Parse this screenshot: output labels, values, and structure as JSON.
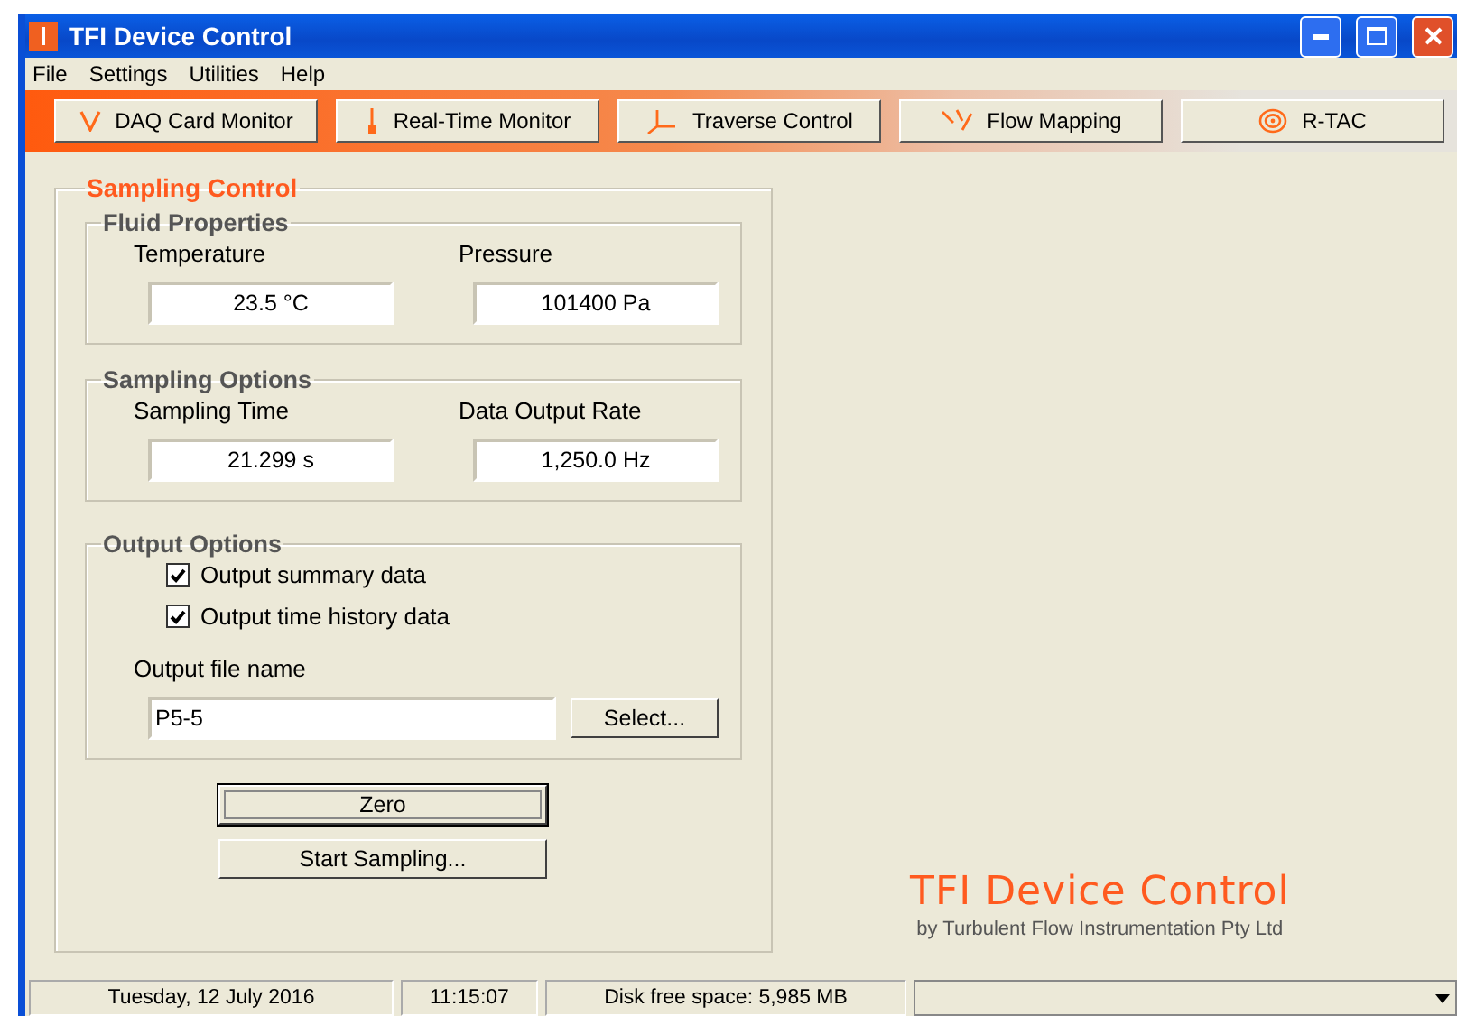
{
  "window": {
    "title": "TFI Device Control"
  },
  "menu": [
    "File",
    "Settings",
    "Utilities",
    "Help"
  ],
  "toolbar": [
    {
      "label": "DAQ Card Monitor",
      "kind": "daq"
    },
    {
      "label": "Real-Time Monitor",
      "kind": "probe"
    },
    {
      "label": "Traverse Control",
      "kind": "axes"
    },
    {
      "label": "Flow Mapping",
      "kind": "flow"
    },
    {
      "label": "R-TAC",
      "kind": "rtac"
    }
  ],
  "sampling_control": {
    "title": "Sampling Control",
    "fluid_properties": {
      "title": "Fluid Properties",
      "fields": [
        {
          "label": "Temperature",
          "value": "23.5 °C"
        },
        {
          "label": "Pressure",
          "value": "101400 Pa"
        }
      ]
    },
    "sampling_options": {
      "title": "Sampling Options",
      "fields": [
        {
          "label": "Sampling Time",
          "value": "21.299 s"
        },
        {
          "label": "Data Output Rate",
          "value": "1,250.0 Hz"
        }
      ]
    },
    "output_options": {
      "title": "Output Options",
      "checkboxes": [
        {
          "label": "Output summary data",
          "checked": true
        },
        {
          "label": "Output time history data",
          "checked": true
        }
      ],
      "file_label": "Output file name",
      "file_value": "P5-5",
      "select_button": "Select..."
    },
    "buttons": [
      {
        "label": "Zero",
        "focused": true
      },
      {
        "label": "Start Sampling...",
        "focused": false
      }
    ]
  },
  "branding": {
    "title": "TFI Device Control",
    "subtitle": "by Turbulent Flow Instrumentation Pty Ltd"
  },
  "status_bar": [
    "Tuesday, 12 July 2016",
    "11:15:07",
    "Disk free space: 5,985 MB"
  ]
}
